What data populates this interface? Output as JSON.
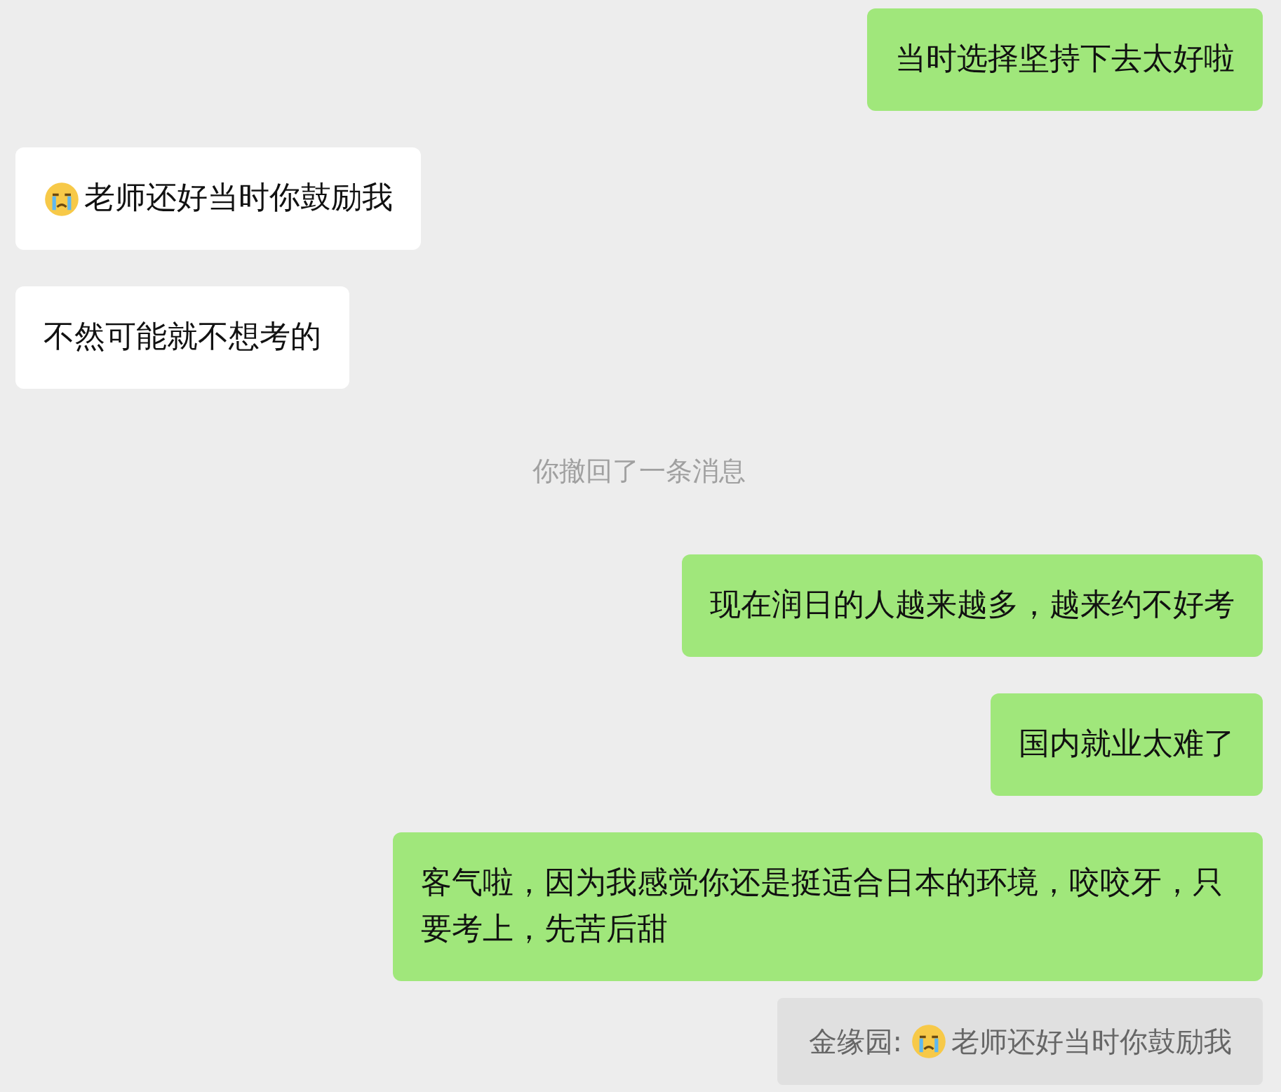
{
  "messages": [
    {
      "kind": "sent",
      "text": "当时选择坚持下去太好啦",
      "emoji_prefix": false
    },
    {
      "kind": "received",
      "text": "老师还好当时你鼓励我",
      "emoji_prefix": true
    },
    {
      "kind": "received",
      "text": "不然可能就不想考的",
      "emoji_prefix": false
    },
    {
      "kind": "system",
      "text": "你撤回了一条消息"
    },
    {
      "kind": "sent",
      "text": "现在润日的人越来越多，越来约不好考",
      "emoji_prefix": false
    },
    {
      "kind": "sent",
      "text": "国内就业太难了",
      "emoji_prefix": false
    },
    {
      "kind": "sent",
      "text": "客气啦，因为我感觉你还是挺适合日本的环境，咬咬牙，只要考上，先苦后甜",
      "emoji_prefix": false
    },
    {
      "kind": "quote",
      "sender": "金缘园:",
      "text": "老师还好当时你鼓励我",
      "emoji_prefix": true
    }
  ]
}
